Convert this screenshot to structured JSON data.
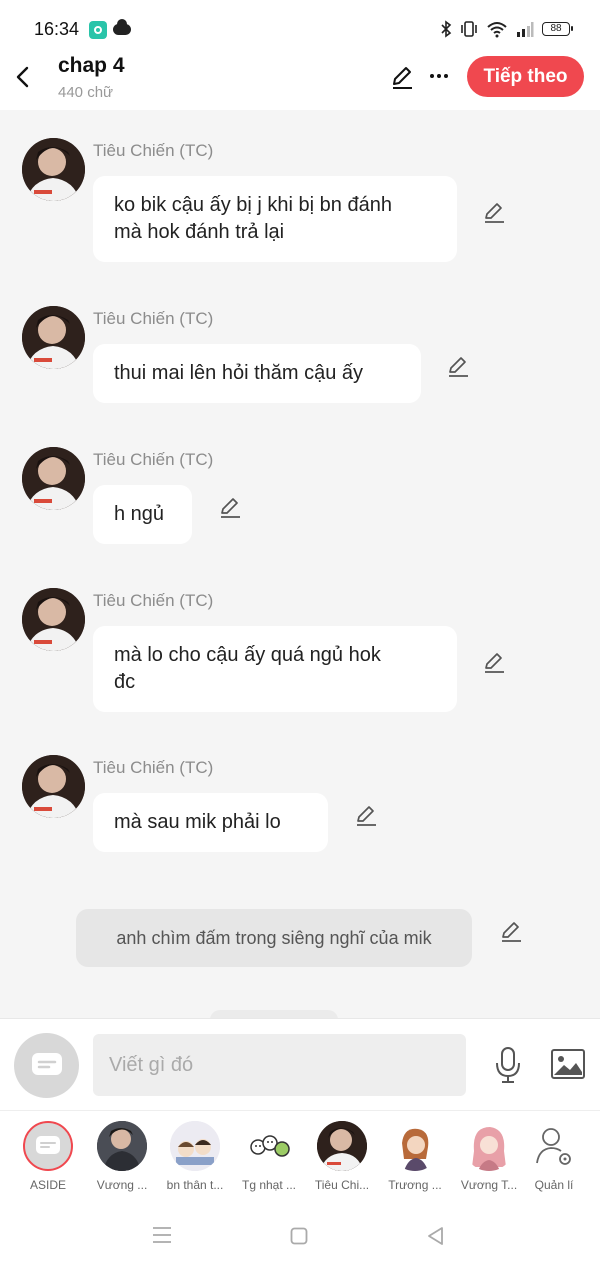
{
  "status_bar": {
    "time": "16:34",
    "battery": "88"
  },
  "header": {
    "title": "chap 4",
    "subtitle": "440 chữ",
    "next_label": "Tiếp theo"
  },
  "messages": [
    {
      "sender": "Tiêu Chiến (TC)",
      "text": "ko bik cậu ấy bị j khi bị bn đánh\nmà hok đánh trả lại"
    },
    {
      "sender": "Tiêu Chiến (TC)",
      "text": "thui mai lên hỏi thăm cậu ấy"
    },
    {
      "sender": "Tiêu Chiến (TC)",
      "text": "h ngủ"
    },
    {
      "sender": "Tiêu Chiến (TC)",
      "text": "mà lo cho cậu ấy quá ngủ hok\nđc"
    },
    {
      "sender": "Tiêu Chiến (TC)",
      "text": "mà sau mik phải lo"
    }
  ],
  "aside_message": "anh chìm đấm trong siêng nghĩ của mik",
  "input": {
    "placeholder": "Viết gì đó"
  },
  "characters": [
    {
      "label": "ASIDE"
    },
    {
      "label": "Vương ..."
    },
    {
      "label": "bn thân t..."
    },
    {
      "label": "Tg nhạt ..."
    },
    {
      "label": "Tiêu Chi..."
    },
    {
      "label": "Trương ..."
    },
    {
      "label": "Vương T..."
    },
    {
      "label": "Quản lí"
    }
  ],
  "colors": {
    "accent": "#f0484f",
    "background": "#f5f5f5"
  }
}
